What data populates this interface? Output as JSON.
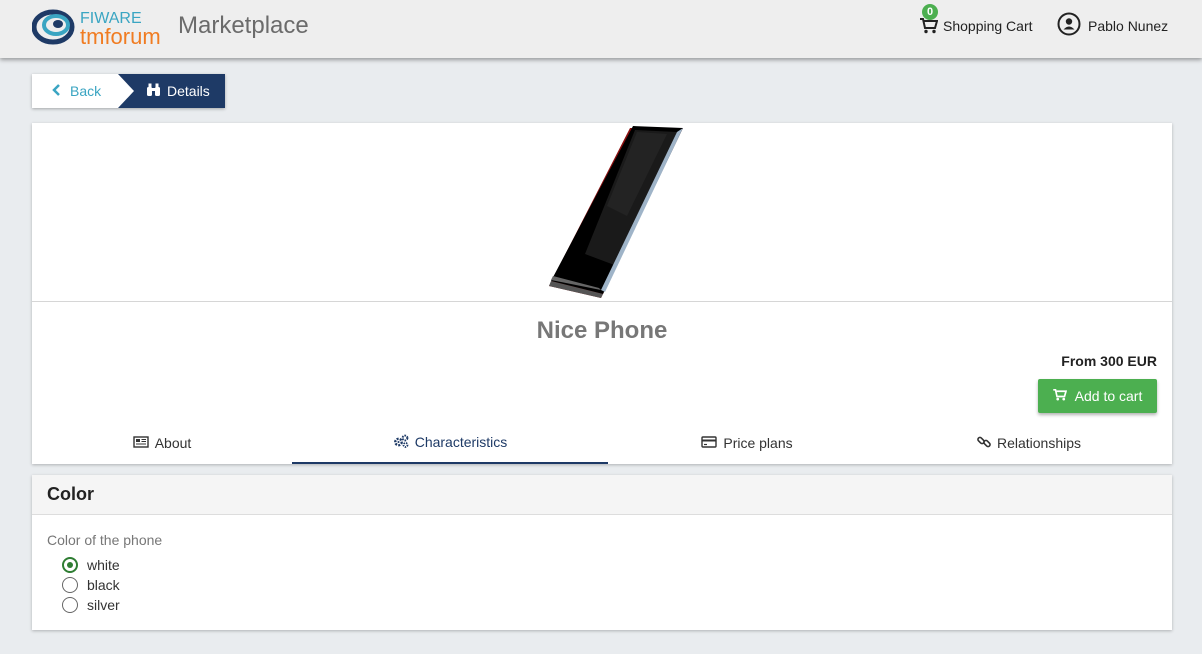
{
  "header": {
    "logo_text_top": "FIWARE",
    "logo_text_bottom": "tmforum",
    "title": "Marketplace",
    "cart_count": "0",
    "cart_label": "Shopping Cart",
    "user_name": "Pablo Nunez"
  },
  "breadcrumb": {
    "back_label": "Back",
    "current_label": "Details"
  },
  "product": {
    "name": "Nice Phone",
    "price": "From 300 EUR",
    "add_to_cart_label": "Add to cart"
  },
  "tabs": [
    {
      "label": "About",
      "icon": "newspaper-icon",
      "active": false
    },
    {
      "label": "Characteristics",
      "icon": "gears-icon",
      "active": true
    },
    {
      "label": "Price plans",
      "icon": "credit-card-icon",
      "active": false
    },
    {
      "label": "Relationships",
      "icon": "link-icon",
      "active": false
    }
  ],
  "characteristic": {
    "title": "Color",
    "description": "Color of the phone",
    "options": [
      {
        "label": "white",
        "selected": true
      },
      {
        "label": "black",
        "selected": false
      },
      {
        "label": "silver",
        "selected": false
      }
    ]
  },
  "colors": {
    "brand_navy": "#1e3a66",
    "accent_green": "#4caf50",
    "link_blue": "#3aa5c2"
  }
}
